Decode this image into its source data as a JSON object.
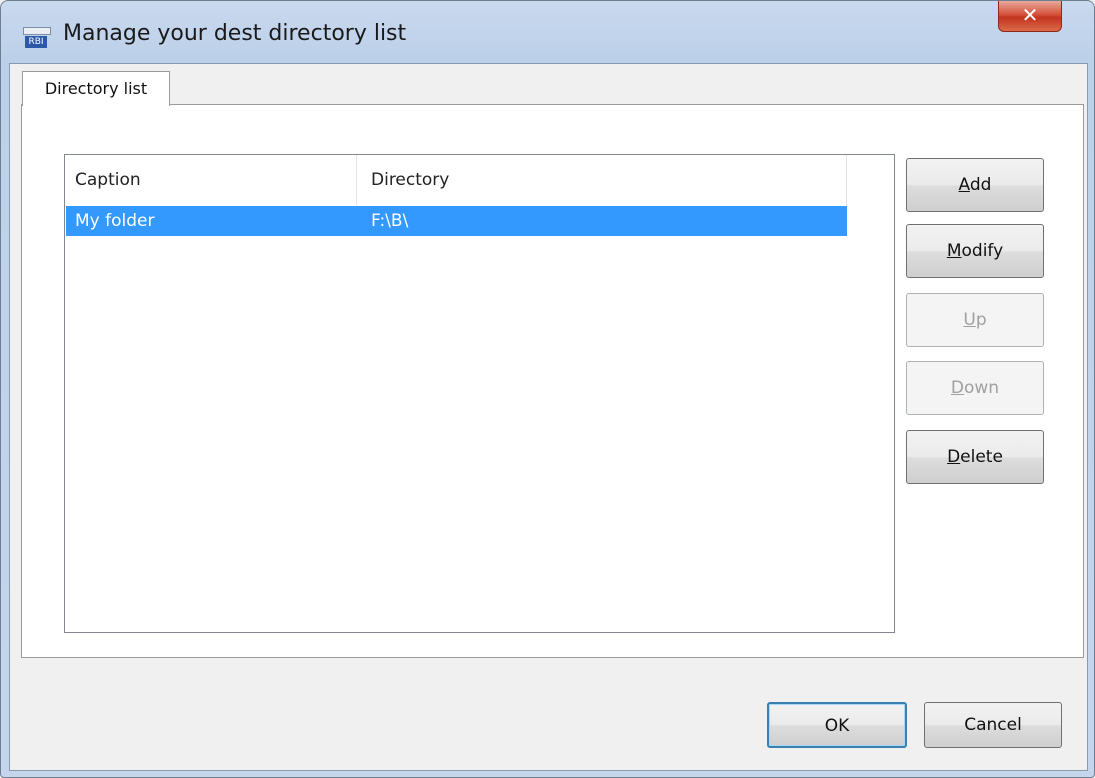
{
  "window": {
    "title": "Manage your dest directory list",
    "icon_text": "RBI",
    "close_glyph": "✕"
  },
  "tabs": [
    {
      "label": "Directory list",
      "selected": true
    }
  ],
  "listview": {
    "columns": [
      "Caption",
      "Directory"
    ],
    "rows": [
      {
        "caption": "My folder",
        "directory": "F:\\B\\",
        "selected": true
      }
    ]
  },
  "side_buttons": {
    "add": {
      "accel": "A",
      "rest": "dd",
      "enabled": true
    },
    "modify": {
      "accel": "M",
      "rest": "odify",
      "enabled": true
    },
    "up": {
      "accel": "U",
      "rest": "p",
      "enabled": false
    },
    "down": {
      "accel": "D",
      "rest": "own",
      "enabled": false
    },
    "delete": {
      "accel": "D",
      "rest": "elete",
      "enabled": true
    }
  },
  "footer": {
    "ok_label": "OK",
    "cancel_label": "Cancel"
  },
  "colors": {
    "selection": "#3399ff",
    "close_button": "#c2341d",
    "default_button_border": "#3c7fb1"
  }
}
